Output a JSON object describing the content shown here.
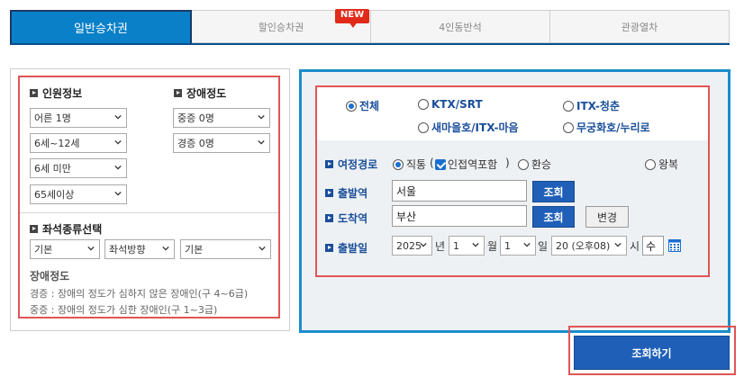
{
  "tabs": [
    {
      "label": "일반승차권",
      "active": true
    },
    {
      "label": "할인승차권",
      "badge": "NEW"
    },
    {
      "label": "4인동반석"
    },
    {
      "label": "관광열차"
    }
  ],
  "passenger": {
    "title": "인원정보",
    "adult": "어른 1명",
    "child": "6세~12세",
    "infant": "6세 미만",
    "senior": "65세이상"
  },
  "disability": {
    "title": "장애정도",
    "severe": "중증 0명",
    "mild": "경증 0명"
  },
  "seat": {
    "title": "좌석종류선택",
    "type": "기본",
    "direction": "좌석방향",
    "option": "기본"
  },
  "disability_desc": {
    "title": "장애정도",
    "mild_line": "경증 : 장애의 정도가 심하지 않은 장애인(구 4~6급)",
    "severe_line": "중증 : 장애의 정도가 심한 장애인(구 1~3급)"
  },
  "train_types": {
    "all": "전체",
    "ktx": "KTX/SRT",
    "itx_cheongchun": "ITX-청춘",
    "saemaeul": "새마을호/ITX-마음",
    "mugunghwa": "무궁화호/누리로"
  },
  "route": {
    "label": "여정경로",
    "direct": "직통",
    "open_paren": "(",
    "nearby": "인접역포함",
    "close_paren": ")",
    "transfer": "환승",
    "round_trip": "왕복"
  },
  "departure": {
    "label": "출발역",
    "value": "서울",
    "button": "조회"
  },
  "arrival": {
    "label": "도착역",
    "value": "부산",
    "button": "조회",
    "swap": "변경"
  },
  "date": {
    "label": "출발일",
    "year": "2025",
    "year_unit": "년",
    "month": "1",
    "month_unit": "월",
    "day": "1",
    "day_unit": "일",
    "hour": "20 (오후08)",
    "hour_unit": "시",
    "weekday": "수"
  },
  "search_button": "조회하기",
  "colors": {
    "accent": "#0a80c8",
    "button": "#1f5fb8",
    "highlight": "#e05555"
  }
}
